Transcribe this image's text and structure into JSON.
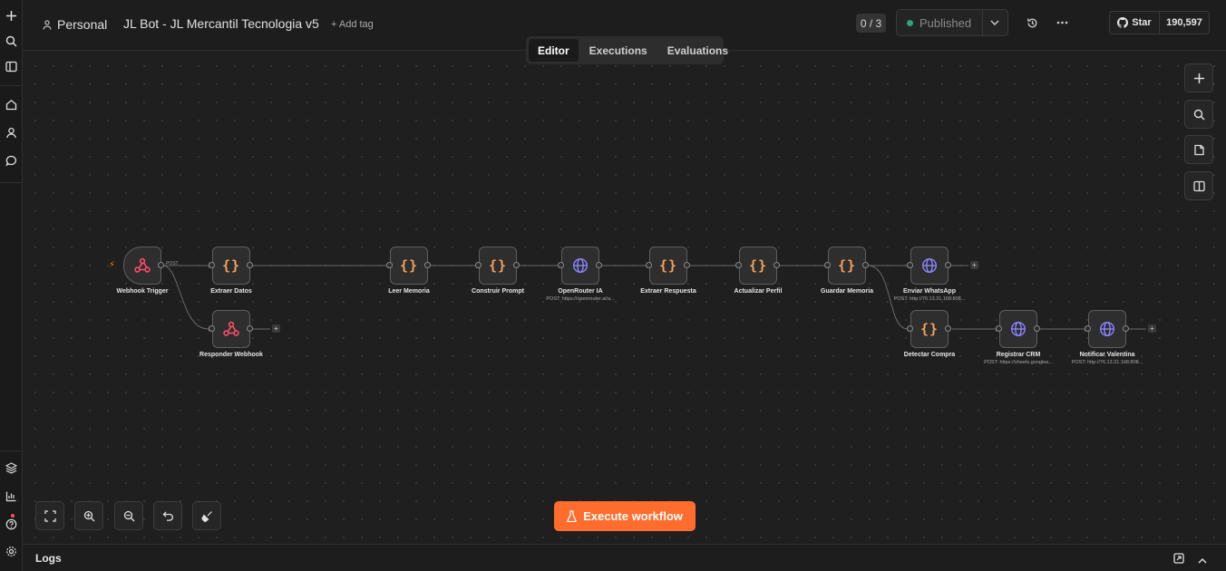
{
  "header": {
    "project": "Personal",
    "workflow_title": "JL Bot - JL Mercantil Tecnologia v5",
    "add_tag": "+ Add tag",
    "counter": "0 / 3",
    "status": "Published",
    "github_star": "Star",
    "github_count": "190,597"
  },
  "tabs": [
    "Editor",
    "Executions",
    "Evaluations"
  ],
  "nodes": [
    {
      "id": "webhook_trigger",
      "label": "Webhook Trigger",
      "kind": "webhook-icon"
    },
    {
      "id": "extraer_datos",
      "label": "Extraer Datos",
      "kind": "code-icon"
    },
    {
      "id": "responder_webhook",
      "label": "Responder Webhook",
      "kind": "webhook-icon"
    },
    {
      "id": "leer_memoria",
      "label": "Leer Memoria",
      "kind": "code-icon"
    },
    {
      "id": "construir_prompt",
      "label": "Construir Prompt",
      "kind": "code-icon"
    },
    {
      "id": "openrouter_ia",
      "label": "OpenRouter IA",
      "sublabel": "POST: https://openrouter.ai/a...",
      "kind": "globe-icon"
    },
    {
      "id": "extraer_respuesta",
      "label": "Extraer Respuesta",
      "kind": "code-icon"
    },
    {
      "id": "actualizar_perfil",
      "label": "Actualizar Perfil",
      "kind": "code-icon"
    },
    {
      "id": "guardar_memoria",
      "label": "Guardar Memoria",
      "kind": "code-icon"
    },
    {
      "id": "enviar_whatsapp",
      "label": "Enviar WhatsApp",
      "sublabel": "POST: http://76.13.31.168:808...",
      "kind": "globe-icon"
    },
    {
      "id": "detectar_compra",
      "label": "Detectar Compra",
      "kind": "code-icon"
    },
    {
      "id": "registrar_crm",
      "label": "Registrar CRM",
      "sublabel": "POST: https://sheets.googlea...",
      "kind": "globe-icon"
    },
    {
      "id": "notificar_valentina",
      "label": "Notificar Valentina",
      "sublabel": "POST: http://76.13.31.168:808...",
      "kind": "globe-icon"
    }
  ],
  "edge_tags": {
    "post": "POST"
  },
  "execute_button": "Execute workflow",
  "logs": {
    "title": "Logs"
  },
  "colors": {
    "accent": "#ff6d2e",
    "published_dot": "#2aa37a",
    "webhook_icon": "#ff4d6a",
    "code_icon": "#f5a25d",
    "globe_icon": "#8b85ff"
  }
}
